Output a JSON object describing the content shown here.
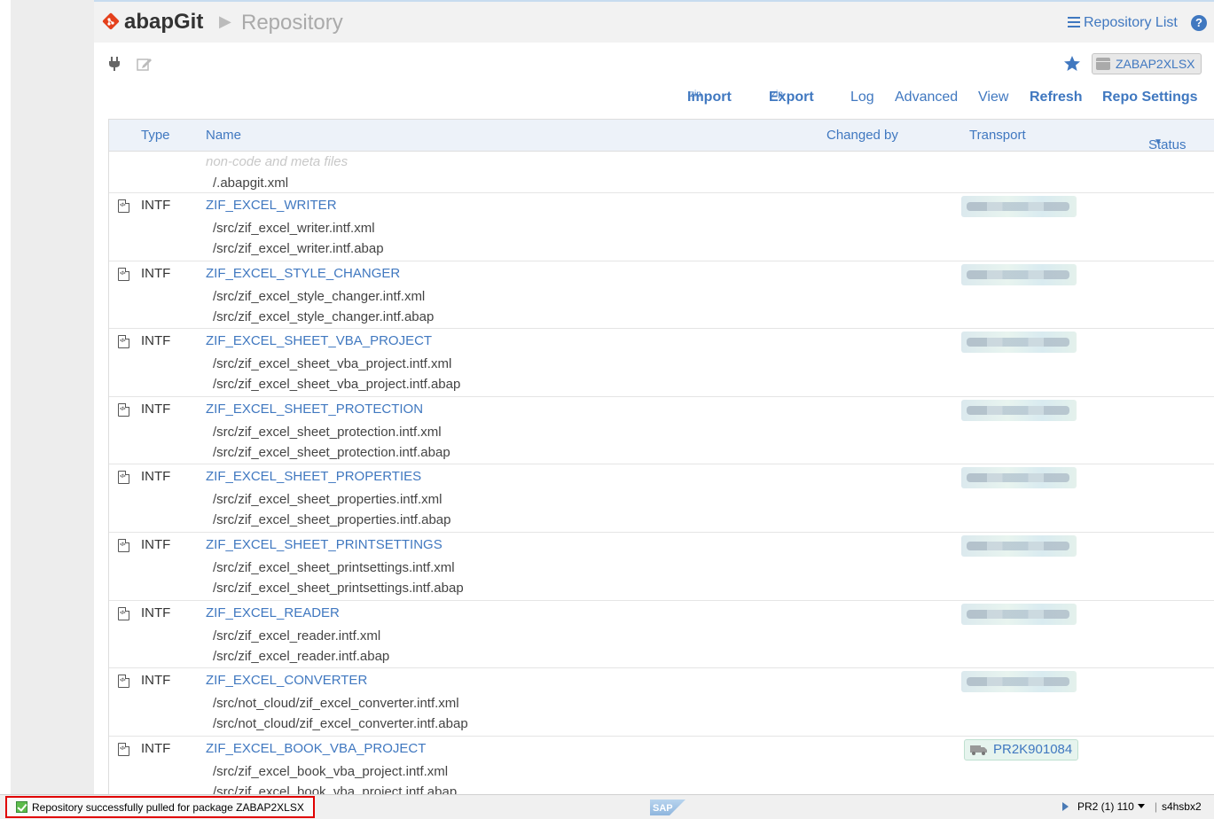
{
  "header": {
    "logo_text": "abapGit",
    "breadcrumb_page": "Repository",
    "repo_list_label": "Repository List",
    "help_symbol": "?"
  },
  "toolbar": {
    "package_badge": "ZABAP2XLSX",
    "menu": {
      "import_label": "Import",
      "import_sup": "zip",
      "export_label": "Export",
      "export_sup": "zip",
      "log_label": "Log",
      "advanced_label": "Advanced",
      "view_label": "View",
      "refresh_label": "Refresh",
      "repo_settings_label": "Repo Settings"
    }
  },
  "table": {
    "columns": {
      "type": "Type",
      "name": "Name",
      "changed_by": "Changed by",
      "transport": "Transport",
      "status": "Status"
    },
    "meta_row": {
      "label": "non-code and meta files",
      "file": "/.abapgit.xml"
    },
    "rows": [
      {
        "type": "INTF",
        "name": "ZIF_EXCEL_WRITER",
        "files": [
          "/src/zif_excel_writer.intf.xml",
          "/src/zif_excel_writer.intf.abap"
        ],
        "transport": ""
      },
      {
        "type": "INTF",
        "name": "ZIF_EXCEL_STYLE_CHANGER",
        "files": [
          "/src/zif_excel_style_changer.intf.xml",
          "/src/zif_excel_style_changer.intf.abap"
        ],
        "transport": ""
      },
      {
        "type": "INTF",
        "name": "ZIF_EXCEL_SHEET_VBA_PROJECT",
        "files": [
          "/src/zif_excel_sheet_vba_project.intf.xml",
          "/src/zif_excel_sheet_vba_project.intf.abap"
        ],
        "transport": ""
      },
      {
        "type": "INTF",
        "name": "ZIF_EXCEL_SHEET_PROTECTION",
        "files": [
          "/src/zif_excel_sheet_protection.intf.xml",
          "/src/zif_excel_sheet_protection.intf.abap"
        ],
        "transport": ""
      },
      {
        "type": "INTF",
        "name": "ZIF_EXCEL_SHEET_PROPERTIES",
        "files": [
          "/src/zif_excel_sheet_properties.intf.xml",
          "/src/zif_excel_sheet_properties.intf.abap"
        ],
        "transport": ""
      },
      {
        "type": "INTF",
        "name": "ZIF_EXCEL_SHEET_PRINTSETTINGS",
        "files": [
          "/src/zif_excel_sheet_printsettings.intf.xml",
          "/src/zif_excel_sheet_printsettings.intf.abap"
        ],
        "transport": ""
      },
      {
        "type": "INTF",
        "name": "ZIF_EXCEL_READER",
        "files": [
          "/src/zif_excel_reader.intf.xml",
          "/src/zif_excel_reader.intf.abap"
        ],
        "transport": ""
      },
      {
        "type": "INTF",
        "name": "ZIF_EXCEL_CONVERTER",
        "files": [
          "/src/not_cloud/zif_excel_converter.intf.xml",
          "/src/not_cloud/zif_excel_converter.intf.abap"
        ],
        "transport": ""
      },
      {
        "type": "INTF",
        "name": "ZIF_EXCEL_BOOK_VBA_PROJECT",
        "files": [
          "/src/zif_excel_book_vba_project.intf.xml",
          "/src/zif_excel_book_vba_project.intf.abap"
        ],
        "transport": "PR2K901084"
      }
    ]
  },
  "statusbar": {
    "message": "Repository  successfully pulled for package ZABAP2XLSX",
    "system": "PR2 (1) 110",
    "host": "s4hsbx2"
  },
  "colors": {
    "link": "#4078c0",
    "header_bg": "#f2f2f2",
    "table_head_bg": "#edf2f9",
    "status_highlight": "#e00000",
    "logo_red": "#e4401c"
  }
}
